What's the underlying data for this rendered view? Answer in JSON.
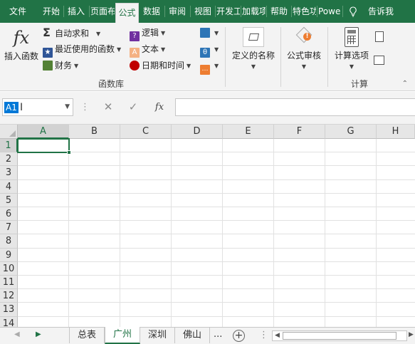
{
  "ribbon_tabs": [
    {
      "label": "文件",
      "active": false
    },
    {
      "label": "开始",
      "active": false
    },
    {
      "label": "插入",
      "active": false
    },
    {
      "label": "页面布局",
      "active": false
    },
    {
      "label": "公式",
      "active": true
    },
    {
      "label": "数据",
      "active": false
    },
    {
      "label": "审阅",
      "active": false
    },
    {
      "label": "视图",
      "active": false
    },
    {
      "label": "开发工具",
      "active": false
    },
    {
      "label": "加载项",
      "active": false
    },
    {
      "label": "帮助",
      "active": false
    },
    {
      "label": "特色功能",
      "active": false
    },
    {
      "label": "Power Pivot",
      "active": false
    }
  ],
  "tell_me": "告诉我",
  "function_library": {
    "insert_function": "插入函数",
    "autosum": "自动求和",
    "recently_used": "最近使用的函数",
    "financial": "财务",
    "logical": "逻辑",
    "text": "文本",
    "date_time": "日期和时间",
    "group_label": "函数库"
  },
  "defined_names": {
    "label": "定义的名称"
  },
  "formula_auditing": {
    "label": "公式审核"
  },
  "calculation": {
    "options": "计算选项",
    "group_label": "计算"
  },
  "formula_bar": {
    "name_box": "A1",
    "fx": "fx",
    "cancel": "✕",
    "enter": "✓",
    "formula": ""
  },
  "columns": [
    "A",
    "B",
    "C",
    "D",
    "E",
    "F",
    "G",
    "H"
  ],
  "rows": [
    "1",
    "2",
    "3",
    "4",
    "5",
    "6",
    "7",
    "8",
    "9",
    "10",
    "11",
    "12",
    "13",
    "14"
  ],
  "active_cell": "A1",
  "sheet_tabs": [
    {
      "label": "总表",
      "active": false
    },
    {
      "label": "广州",
      "active": true
    },
    {
      "label": "深圳",
      "active": false
    },
    {
      "label": "佛山",
      "active": false
    }
  ],
  "sheet_more": "...",
  "colors": {
    "accent": "#217346",
    "selection": "#0078d7"
  }
}
